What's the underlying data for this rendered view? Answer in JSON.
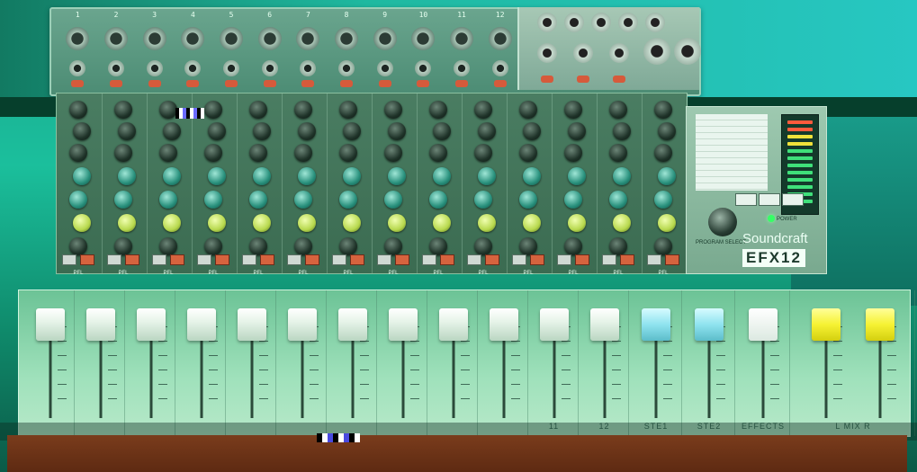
{
  "scene": {
    "description_colors": {
      "background_teal": "#1bbf9c",
      "panel_green": "#3b6b51",
      "fader_area": "#9fe1bb",
      "chassis": "#5e2a12",
      "mute_red": "#d6633e"
    }
  },
  "mixer": {
    "brand": "Soundcraft",
    "model": "EFX12",
    "power_label": "POWER",
    "program_select_label": "PROGRAM SELECT",
    "channel_numbers": [
      "1",
      "2",
      "3",
      "4",
      "5",
      "6",
      "7",
      "8",
      "9",
      "10",
      "11",
      "12"
    ],
    "pfl_labels": [
      "PFL",
      "PFL",
      "PFL",
      "PFL",
      "PFL",
      "PFL",
      "PFL",
      "PFL",
      "PFL",
      "PFL",
      "PFL",
      "PFL",
      "PFL",
      "PFL"
    ],
    "fader_labels": [
      "",
      "",
      "",
      "",
      "",
      "",
      "",
      "",
      "",
      "",
      "11",
      "12",
      "STE1",
      "STE2",
      "EFFECTS",
      "L   MIX   R"
    ]
  }
}
